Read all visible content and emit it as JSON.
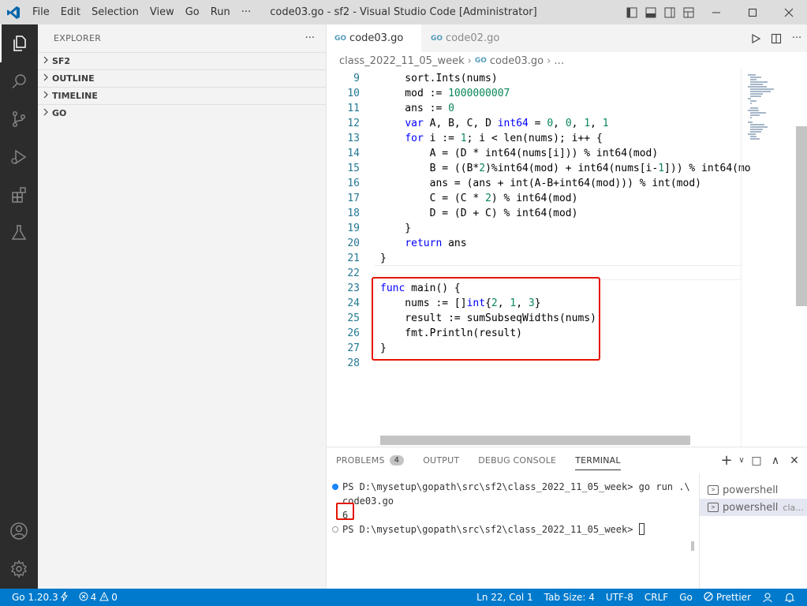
{
  "titlebar": {
    "menu": [
      "File",
      "Edit",
      "Selection",
      "View",
      "Go",
      "Run",
      "···"
    ],
    "title": "code03.go - sf2 - Visual Studio Code [Administrator]"
  },
  "sidebar": {
    "title": "EXPLORER",
    "more": "···",
    "sections": [
      "SF2",
      "OUTLINE",
      "TIMELINE",
      "GO"
    ]
  },
  "tabs": [
    {
      "icon": "GO",
      "label": "code03.go"
    },
    {
      "icon": "GO",
      "label": "code02.go"
    }
  ],
  "breadcrumb": {
    "folder": "class_2022_11_05_week",
    "file_icon": "GO",
    "file": "code03.go",
    "more": "…"
  },
  "editor": {
    "lines": [
      {
        "n": "9",
        "parts": [
          {
            "t": "    sort.Ints(nums)"
          }
        ]
      },
      {
        "n": "10",
        "parts": [
          {
            "t": "    mod := "
          },
          {
            "t": "1000000007",
            "c": "num"
          }
        ]
      },
      {
        "n": "11",
        "parts": [
          {
            "t": "    ans := "
          },
          {
            "t": "0",
            "c": "num"
          }
        ]
      },
      {
        "n": "12",
        "parts": [
          {
            "t": "    "
          },
          {
            "t": "var",
            "c": "kw"
          },
          {
            "t": " A, B, C, D "
          },
          {
            "t": "int64",
            "c": "kw"
          },
          {
            "t": " = "
          },
          {
            "t": "0",
            "c": "num"
          },
          {
            "t": ", "
          },
          {
            "t": "0",
            "c": "num"
          },
          {
            "t": ", "
          },
          {
            "t": "1",
            "c": "num"
          },
          {
            "t": ", "
          },
          {
            "t": "1",
            "c": "num"
          }
        ]
      },
      {
        "n": "13",
        "parts": [
          {
            "t": "    "
          },
          {
            "t": "for",
            "c": "kw"
          },
          {
            "t": " i := "
          },
          {
            "t": "1",
            "c": "num"
          },
          {
            "t": "; i < len(nums); i++ {"
          }
        ]
      },
      {
        "n": "14",
        "parts": [
          {
            "t": "        A = (D * int64(nums[i])) % int64(mod)"
          }
        ]
      },
      {
        "n": "15",
        "parts": [
          {
            "t": "        B = ((B*"
          },
          {
            "t": "2",
            "c": "num"
          },
          {
            "t": ")%int64(mod) + int64(nums[i-"
          },
          {
            "t": "1",
            "c": "num"
          },
          {
            "t": "])) % int64(mo"
          }
        ]
      },
      {
        "n": "16",
        "parts": [
          {
            "t": "        ans = (ans + int(A-B+int64(mod))) % int(mod)"
          }
        ]
      },
      {
        "n": "17",
        "parts": [
          {
            "t": "        C = (C * "
          },
          {
            "t": "2",
            "c": "num"
          },
          {
            "t": ") % int64(mod)"
          }
        ]
      },
      {
        "n": "18",
        "parts": [
          {
            "t": "        D = (D + C) % int64(mod)"
          }
        ]
      },
      {
        "n": "19",
        "parts": [
          {
            "t": "    }"
          }
        ]
      },
      {
        "n": "20",
        "parts": [
          {
            "t": "    "
          },
          {
            "t": "return",
            "c": "kw"
          },
          {
            "t": " ans"
          }
        ]
      },
      {
        "n": "21",
        "parts": [
          {
            "t": "}"
          }
        ]
      },
      {
        "n": "22",
        "parts": []
      },
      {
        "n": "23",
        "parts": [
          {
            "t": "func",
            "c": "kw"
          },
          {
            "t": " main() {"
          }
        ]
      },
      {
        "n": "24",
        "parts": [
          {
            "t": "    nums := []"
          },
          {
            "t": "int",
            "c": "kw"
          },
          {
            "t": "{"
          },
          {
            "t": "2",
            "c": "num"
          },
          {
            "t": ", "
          },
          {
            "t": "1",
            "c": "num"
          },
          {
            "t": ", "
          },
          {
            "t": "3",
            "c": "num"
          },
          {
            "t": "}"
          }
        ]
      },
      {
        "n": "25",
        "parts": [
          {
            "t": "    result := sumSubseqWidths(nums)"
          }
        ]
      },
      {
        "n": "26",
        "parts": [
          {
            "t": "    fmt.Println(result)"
          }
        ]
      },
      {
        "n": "27",
        "parts": [
          {
            "t": "}"
          }
        ]
      },
      {
        "n": "28",
        "parts": []
      }
    ]
  },
  "panel": {
    "tabs": [
      "PROBLEMS",
      "OUTPUT",
      "DEBUG CONSOLE",
      "TERMINAL"
    ],
    "problems_count": "4",
    "actions": [
      "+",
      "∨",
      "□",
      "∧",
      "✕"
    ],
    "terminal": {
      "line1": "PS D:\\mysetup\\gopath\\src\\sf2\\class_2022_11_05_week> go run .\\",
      "line2": "code03.go",
      "output": "6",
      "prompt": "PS D:\\mysetup\\gopath\\src\\sf2\\class_2022_11_05_week> "
    },
    "terminal_list": [
      {
        "icon": ">",
        "label": "powershell",
        "sub": ""
      },
      {
        "icon": ">",
        "label": "powershell",
        "sub": "cla..."
      }
    ]
  },
  "statusbar": {
    "go_version": "Go 1.20.3",
    "errors": "4",
    "warnings": "0",
    "position": "Ln 22, Col 1",
    "tab_size": "Tab Size: 4",
    "encoding": "UTF-8",
    "eol": "CRLF",
    "language": "Go",
    "prettier": "Prettier"
  },
  "colors": {
    "accent": "#007acc",
    "activity_bar": "#2c2c2c",
    "highlight": "#e51400",
    "keyword": "#0000ff",
    "number": "#098658",
    "line_number": "#237893"
  }
}
